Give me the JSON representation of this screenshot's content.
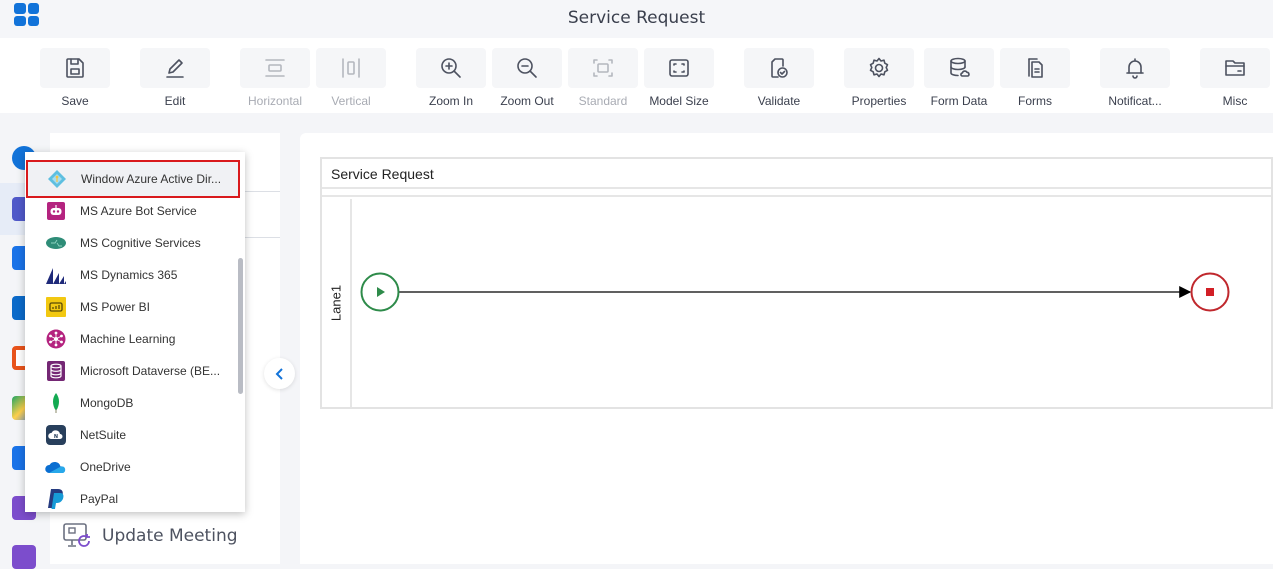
{
  "header": {
    "title": "Service Request",
    "app_menu_icon": "app-grid-icon"
  },
  "toolbar": {
    "buttons": [
      {
        "id": "save",
        "label": "Save",
        "icon": "save-icon",
        "enabled": true
      },
      {
        "id": "edit",
        "label": "Edit",
        "icon": "edit-icon",
        "enabled": true
      },
      {
        "id": "horizontal",
        "label": "Horizontal",
        "icon": "horizontal-icon",
        "enabled": false
      },
      {
        "id": "vertical",
        "label": "Vertical",
        "icon": "vertical-icon",
        "enabled": false
      },
      {
        "id": "zoom-in",
        "label": "Zoom In",
        "icon": "zoom-in-icon",
        "enabled": true
      },
      {
        "id": "zoom-out",
        "label": "Zoom Out",
        "icon": "zoom-out-icon",
        "enabled": true
      },
      {
        "id": "standard",
        "label": "Standard",
        "icon": "standard-icon",
        "enabled": false
      },
      {
        "id": "model-size",
        "label": "Model Size",
        "icon": "model-size-icon",
        "enabled": true
      },
      {
        "id": "validate",
        "label": "Validate",
        "icon": "validate-icon",
        "enabled": true
      },
      {
        "id": "properties",
        "label": "Properties",
        "icon": "gear-icon",
        "enabled": true
      },
      {
        "id": "form-data",
        "label": "Form Data",
        "icon": "database-icon",
        "enabled": true
      },
      {
        "id": "forms",
        "label": "Forms",
        "icon": "forms-icon",
        "enabled": true
      },
      {
        "id": "notifications",
        "label": "Notificat...",
        "icon": "bell-icon",
        "enabled": true
      },
      {
        "id": "misc",
        "label": "Misc",
        "icon": "folder-icon",
        "enabled": true
      }
    ]
  },
  "left_rail": {
    "icons": [
      "add-icon",
      "teams-icon",
      "exchange-icon",
      "sharepoint-icon",
      "office-icon",
      "google-drive-icon",
      "forms-app-icon",
      "text-icon",
      "menu-icon"
    ]
  },
  "panel": {
    "update_meeting_label": "Update Meeting"
  },
  "dropdown": {
    "selected_index": 0,
    "items": [
      {
        "label": "Window Azure Active Dir...",
        "icon": "azure-ad-icon"
      },
      {
        "label": "MS Azure Bot Service",
        "icon": "azure-bot-icon"
      },
      {
        "label": "MS Cognitive Services",
        "icon": "cognitive-services-icon"
      },
      {
        "label": "MS Dynamics 365",
        "icon": "dynamics-365-icon"
      },
      {
        "label": "MS Power BI",
        "icon": "power-bi-icon"
      },
      {
        "label": "Machine Learning",
        "icon": "machine-learning-icon"
      },
      {
        "label": "Microsoft Dataverse (BE...",
        "icon": "dataverse-icon"
      },
      {
        "label": "MongoDB",
        "icon": "mongodb-icon"
      },
      {
        "label": "NetSuite",
        "icon": "netsuite-icon"
      },
      {
        "label": "OneDrive",
        "icon": "onedrive-icon"
      },
      {
        "label": "PayPal",
        "icon": "paypal-icon"
      }
    ]
  },
  "canvas": {
    "pool_title": "Service Request",
    "lane_label": "Lane1",
    "start_event": "start-event",
    "end_event": "end-event",
    "colors": {
      "start": "#2e8b4a",
      "end": "#c0282d"
    }
  }
}
